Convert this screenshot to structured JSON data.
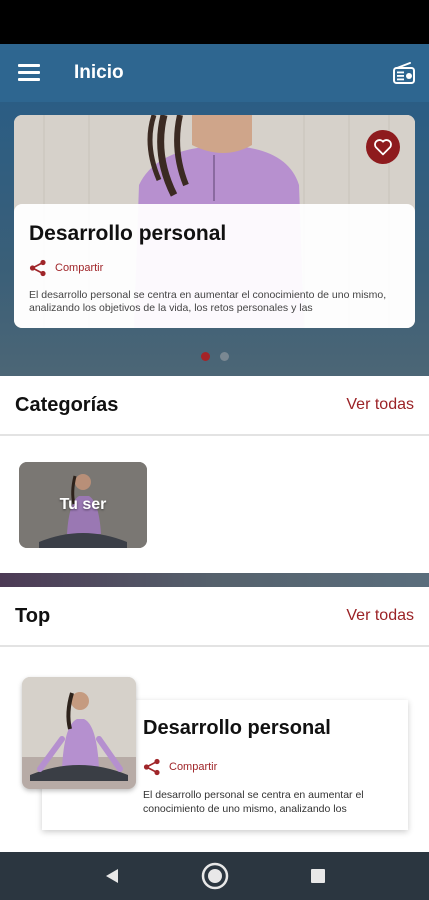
{
  "app_bar": {
    "title": "Inicio",
    "menu_icon": "hamburger-menu-icon",
    "radio_icon": "radio-icon",
    "background_color": "#2e6690"
  },
  "featured": {
    "title": "Desarrollo personal",
    "share_label": "Compartir",
    "description": "El desarrollo personal se centra en aumentar el conocimiento de uno mismo, analizando los objetivos de la vida, los retos personales y las",
    "favorite_icon": "heart-icon",
    "favorite_color": "#8e1b1e",
    "carousel_pages": 2,
    "carousel_active": 1
  },
  "categories": {
    "title": "Categorías",
    "see_all": "Ver todas",
    "items": [
      {
        "label": "Tu ser"
      }
    ]
  },
  "top": {
    "title": "Top",
    "see_all": "Ver todas",
    "items": [
      {
        "title": "Desarrollo personal",
        "share_label": "Compartir",
        "description": "El desarrollo personal se centra en aumentar el conocimiento de uno mismo, analizando los"
      }
    ]
  },
  "nav_bar": {
    "back_icon": "back-triangle-icon",
    "home_icon": "home-circle-icon",
    "recents_icon": "recents-square-icon"
  },
  "colors": {
    "accent": "#9b2226",
    "primary": "#2e6690"
  }
}
